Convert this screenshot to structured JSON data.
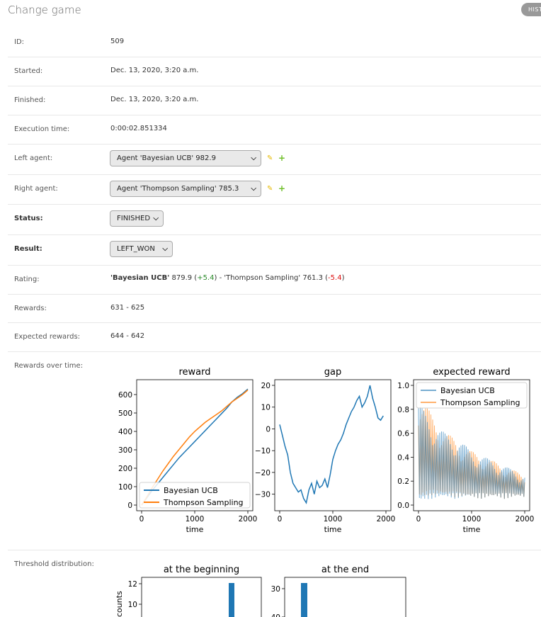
{
  "header": {
    "title": "Change game",
    "history_label": "HISTORY"
  },
  "fields": {
    "id": {
      "label": "ID:",
      "value": "509"
    },
    "started": {
      "label": "Started:",
      "value": "Dec. 13, 2020, 3:20 a.m."
    },
    "finished": {
      "label": "Finished:",
      "value": "Dec. 13, 2020, 3:20 a.m."
    },
    "execution_time": {
      "label": "Execution time:",
      "value": "0:00:02.851334"
    },
    "left_agent": {
      "label": "Left agent:",
      "value": "Agent 'Bayesian UCB' 982.9"
    },
    "right_agent": {
      "label": "Right agent:",
      "value": "Agent 'Thompson Sampling' 785.3"
    },
    "status": {
      "label": "Status:",
      "value": "FINISHED"
    },
    "result": {
      "label": "Result:",
      "value": "LEFT_WON"
    },
    "rating": {
      "label": "Rating:",
      "left_name": "'Bayesian UCB'",
      "left_value": " 879.9 (",
      "left_delta": "+5.4",
      "sep": ") - 'Thompson Sampling' 761.3 (",
      "right_delta": "-5.4",
      "end": ")"
    },
    "rewards": {
      "label": "Rewards:",
      "value": "631 - 625"
    },
    "expected_rewards": {
      "label": "Expected rewards:",
      "value": "644 - 642"
    },
    "rewards_over_time": {
      "label": "Rewards over time:"
    },
    "threshold_distribution": {
      "label": "Threshold distribution:"
    }
  },
  "colors": {
    "series_blue": "#1f77b4",
    "series_orange": "#ff7f0e"
  },
  "chart_data": [
    {
      "type": "line",
      "title": "reward",
      "xlabel": "time",
      "ylabel": "",
      "xlim": [
        0,
        2000
      ],
      "ylim": [
        0,
        650
      ],
      "xticks": [
        "0",
        "1000",
        "2000"
      ],
      "yticks": [
        "0",
        "100",
        "200",
        "300",
        "400",
        "500",
        "600"
      ],
      "legend": "lower-right",
      "series": [
        {
          "name": "Bayesian UCB",
          "x": [
            0,
            100,
            200,
            300,
            400,
            500,
            600,
            700,
            800,
            900,
            1000,
            1100,
            1200,
            1300,
            1400,
            1500,
            1600,
            1700,
            1800,
            1900,
            2000
          ],
          "values": [
            0,
            40,
            80,
            115,
            150,
            185,
            220,
            255,
            285,
            315,
            345,
            375,
            405,
            435,
            465,
            495,
            525,
            560,
            585,
            605,
            630
          ]
        },
        {
          "name": "Thompson Sampling",
          "x": [
            0,
            100,
            200,
            300,
            400,
            500,
            600,
            700,
            800,
            900,
            1000,
            1100,
            1200,
            1300,
            1400,
            1500,
            1600,
            1700,
            1800,
            1900,
            2000
          ],
          "values": [
            0,
            45,
            95,
            140,
            185,
            225,
            265,
            300,
            335,
            370,
            400,
            425,
            450,
            470,
            490,
            510,
            535,
            560,
            580,
            600,
            625
          ]
        }
      ]
    },
    {
      "type": "line",
      "title": "gap",
      "xlabel": "time",
      "ylabel": "",
      "xlim": [
        0,
        2000
      ],
      "ylim": [
        -35,
        20
      ],
      "xticks": [
        "0",
        "1000",
        "2000"
      ],
      "yticks": [
        "−30",
        "−20",
        "−10",
        "0",
        "10",
        "20"
      ],
      "series": [
        {
          "name": "",
          "x": [
            0,
            50,
            100,
            150,
            200,
            250,
            300,
            350,
            400,
            450,
            500,
            550,
            600,
            650,
            700,
            750,
            800,
            850,
            900,
            950,
            1000,
            1050,
            1100,
            1150,
            1200,
            1250,
            1300,
            1350,
            1400,
            1450,
            1500,
            1550,
            1600,
            1650,
            1700,
            1750,
            1800,
            1850,
            1900,
            1950
          ],
          "values": [
            2,
            -3,
            -8,
            -12,
            -20,
            -25,
            -27,
            -29,
            -28,
            -32,
            -34,
            -28,
            -25,
            -30,
            -24,
            -27,
            -26,
            -23,
            -27,
            -21,
            -14,
            -10,
            -7,
            -5,
            -2,
            2,
            5,
            8,
            10,
            13,
            15,
            10,
            12,
            15,
            20,
            14,
            10,
            5,
            4,
            6
          ]
        }
      ]
    },
    {
      "type": "line",
      "title": "expected reward",
      "xlabel": "time",
      "ylabel": "",
      "xlim": [
        0,
        2000
      ],
      "ylim": [
        0,
        1
      ],
      "xticks": [
        "0",
        "1000",
        "2000"
      ],
      "yticks": [
        "0.0",
        "0.2",
        "0.4",
        "0.6",
        "0.8",
        "1.0"
      ],
      "legend": "upper-right",
      "series": [
        {
          "name": "Bayesian UCB",
          "x": [
            0,
            250,
            500,
            750,
            1000,
            1250,
            1500,
            1750,
            2000
          ],
          "values_high": [
            0.85,
            0.7,
            0.6,
            0.55,
            0.45,
            0.4,
            0.35,
            0.3,
            0.25
          ],
          "values_low": [
            0.02,
            0.05,
            0.05,
            0.05,
            0.05,
            0.05,
            0.05,
            0.05,
            0.05
          ]
        },
        {
          "name": "Thompson Sampling",
          "x": [
            0,
            250,
            500,
            750,
            1000,
            1250,
            1500,
            1750,
            2000
          ],
          "values_high": [
            0.95,
            0.75,
            0.62,
            0.52,
            0.45,
            0.4,
            0.35,
            0.3,
            0.25
          ],
          "values_low": [
            0.05,
            0.08,
            0.07,
            0.06,
            0.05,
            0.05,
            0.05,
            0.05,
            0.05
          ]
        }
      ]
    },
    {
      "type": "bar",
      "title": "at the beginning",
      "xlabel": "",
      "ylabel": "counts",
      "yticks": [
        "10",
        "12"
      ]
    },
    {
      "type": "bar",
      "title": "at the end",
      "xlabel": "",
      "ylabel": "",
      "yticks": [
        "30",
        "40"
      ]
    }
  ]
}
